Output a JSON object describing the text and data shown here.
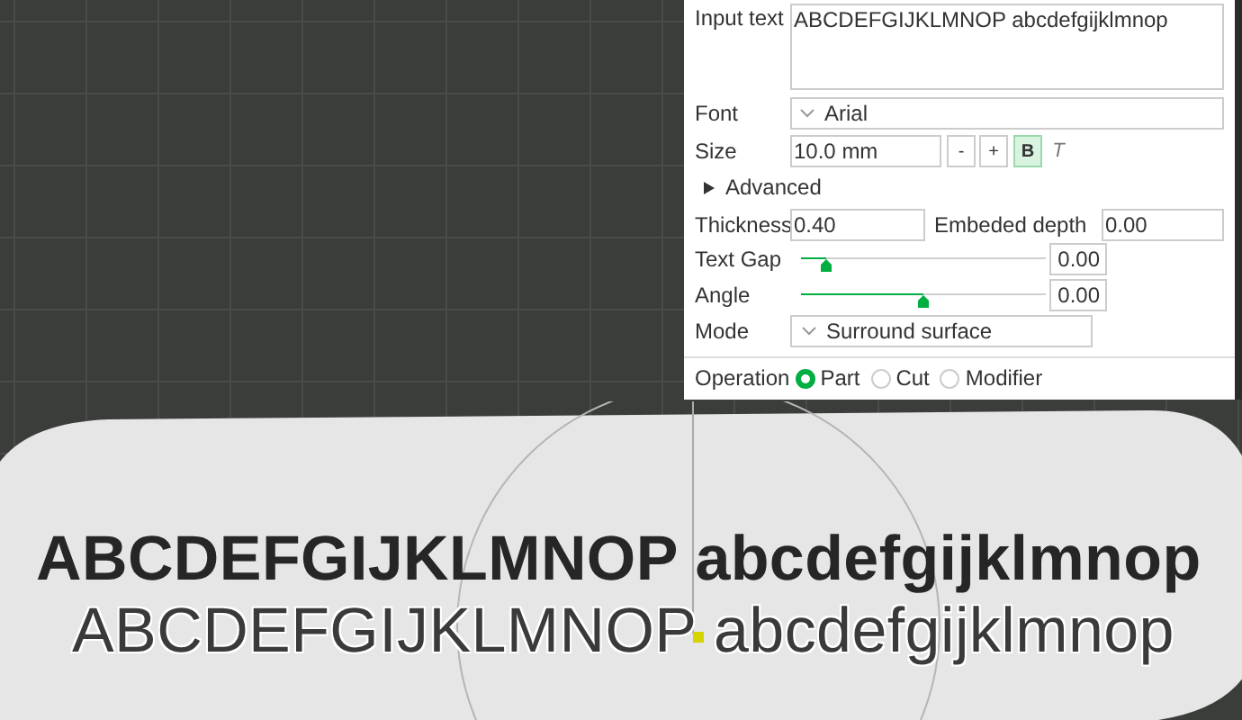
{
  "scene": {
    "texts": [
      {
        "kind": "bold",
        "text": "ABCDEFGIJKLMNOP abcdefgijklmnop"
      },
      {
        "kind": "outlined",
        "text": "ABCDEFGIJKLMNOP abcdefgijklmnop"
      }
    ]
  },
  "panel": {
    "input_text": {
      "label": "Input text",
      "value": "ABCDEFGIJKLMNOP abcdefgijklmnop"
    },
    "font": {
      "label": "Font",
      "value": "Arial"
    },
    "size": {
      "label": "Size",
      "value": "10.0 mm",
      "minus": "-",
      "plus": "+",
      "bold": {
        "label": "B",
        "on": true
      },
      "italic": {
        "label": "T",
        "on": false
      }
    },
    "advanced": {
      "label": "Advanced",
      "expanded": false
    },
    "thickness": {
      "label": "Thickness",
      "value": "0.40"
    },
    "embeded_depth": {
      "label": "Embeded depth",
      "value": "0.00"
    },
    "sliders": [
      {
        "label": "Text Gap",
        "level": 0.1,
        "reading": "0.00"
      },
      {
        "label": "Angle",
        "level": 0.5,
        "reading": "0.00"
      }
    ],
    "mode": {
      "label": "Mode",
      "value": "Surround surface"
    },
    "operation": {
      "label": "Operation",
      "options": [
        {
          "label": "Part",
          "selected": true
        },
        {
          "label": "Cut",
          "selected": false
        },
        {
          "label": "Modifier",
          "selected": false
        }
      ]
    }
  }
}
